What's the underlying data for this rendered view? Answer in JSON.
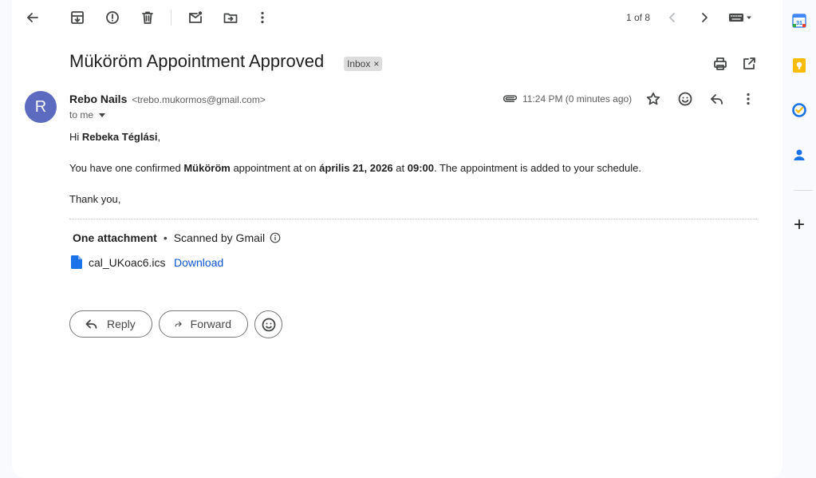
{
  "toolbar": {
    "pager_text": "1 of 8",
    "icons": [
      "back-arrow-icon",
      "archive-icon",
      "report-spam-icon",
      "delete-icon",
      "mark-unread-icon",
      "move-to-icon",
      "more-vert-icon",
      "newer-chevron-icon",
      "older-chevron-icon",
      "keyboard-icon"
    ]
  },
  "email": {
    "subject": "Mükö­röm Appointment Approved",
    "label_chip": "Inbox",
    "label_chip_close": "×",
    "avatar_letter": "R",
    "sender_name": "Rebo Nails",
    "sender_email": "<trebo.mukormos@gmail.com>",
    "recipient": "to me",
    "time": "11:24 PM (0 minutes ago)",
    "body": {
      "greeting_prefix": "Hi ",
      "greeting_name": "Rebeka Téglási",
      "greeting_suffix": ",",
      "line_part1": "You have one confirmed ",
      "line_service": "Mükö­röm",
      "line_part2": " appointment at on ",
      "line_date": "április 21, 2026",
      "line_part3": " at ",
      "line_time": "09:00",
      "line_part4": ". The appointment is added to your schedule.",
      "closing": "Thank you,"
    },
    "attachments": {
      "heading": "One attachment",
      "separator": "•",
      "scanned_text": "Scanned by Gmail",
      "file_name": "cal_UKoac6.ics",
      "download_label": "Download"
    },
    "actions": {
      "reply_label": "Reply",
      "forward_label": "Forward"
    }
  },
  "sidebar": {
    "apps": [
      "calendar-app-icon",
      "keep-app-icon",
      "tasks-app-icon",
      "contacts-app-icon"
    ],
    "calendar_day": "31",
    "add_label": "+"
  },
  "colors": {
    "avatar": "#5c6bc0",
    "link": "#0b57d0",
    "calendar": "#4285f4",
    "keep": "#fbbc04",
    "tasks": "#1a73e8",
    "contacts": "#1a73e8"
  }
}
